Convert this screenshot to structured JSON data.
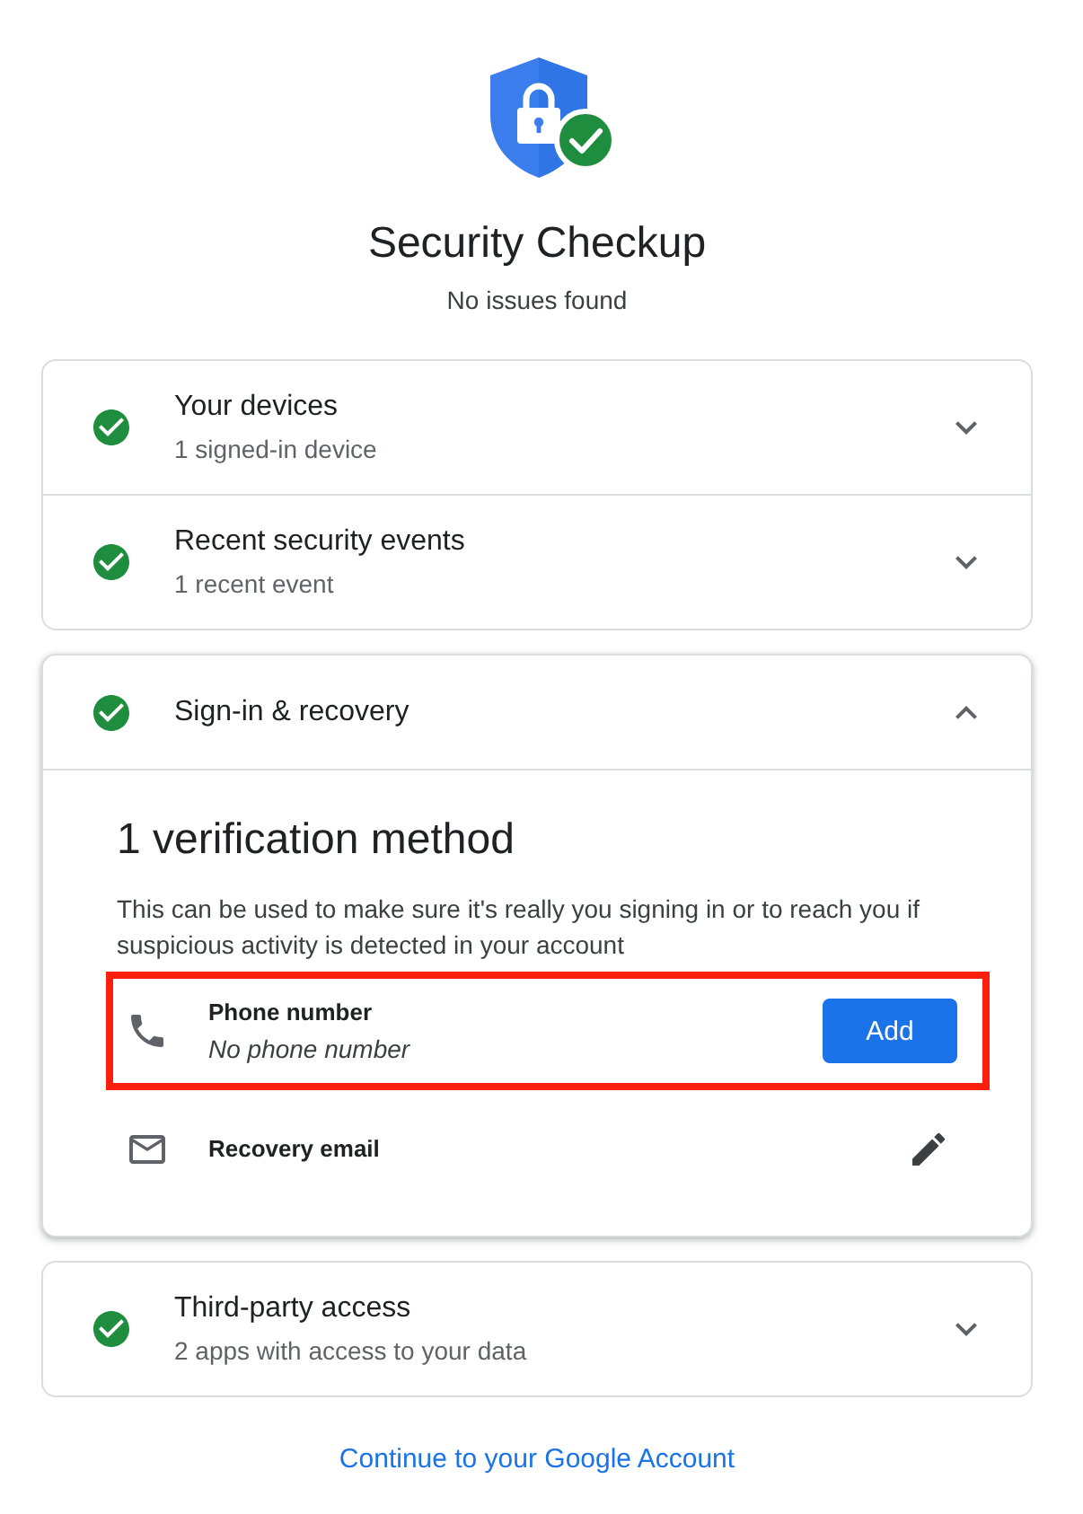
{
  "header": {
    "title": "Security Checkup",
    "subtitle": "No issues found"
  },
  "cards": [
    {
      "sections": [
        {
          "title": "Your devices",
          "subtitle": "1 signed-in device",
          "ok": true,
          "expanded": false
        },
        {
          "title": "Recent security events",
          "subtitle": "1 recent event",
          "ok": true,
          "expanded": false
        }
      ]
    },
    {
      "sections": [
        {
          "title": "Sign-in & recovery",
          "ok": true,
          "expanded": true,
          "detail": {
            "heading": "1 verification method",
            "description": "This can be used to make sure it's really you signing in or to reach you if suspicious activity is detected in your account",
            "methods": [
              {
                "kind": "phone",
                "label": "Phone number",
                "value": "No phone number",
                "highlighted": true,
                "action": {
                  "kind": "button",
                  "label": "Add"
                }
              },
              {
                "kind": "email",
                "label": "Recovery email",
                "highlighted": false,
                "action": {
                  "kind": "edit"
                }
              }
            ]
          }
        }
      ]
    },
    {
      "sections": [
        {
          "title": "Third-party access",
          "subtitle": "2 apps with access to your data",
          "ok": true,
          "expanded": false
        }
      ]
    }
  ],
  "footer_link": "Continue to your Google Account"
}
